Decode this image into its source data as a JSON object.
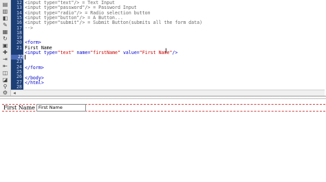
{
  "toolbar": {
    "icons": [
      "file-icon",
      "page-icon",
      "code-icon",
      "wrench-icon",
      "bookmark-icon",
      "refresh-icon",
      "nav-icon",
      "format-icon",
      "indent-icon",
      "outdent-icon",
      "comment-icon",
      "uncomment-icon",
      "search-icon",
      "snippet-icon"
    ]
  },
  "gutter": {
    "lines": [
      "12",
      "13",
      "14",
      "15",
      "16",
      "17",
      "18",
      "19",
      "20",
      "21",
      "22",
      "23",
      "24",
      "25",
      "26",
      "27",
      "28"
    ],
    "active_line": "22"
  },
  "code": {
    "l12": "<input type=\"text\"/> = Text Input",
    "l13": "<input type=\"password\"/> = Password Input",
    "l14": "<input type=\"radio\"/> = Radio selection button",
    "l15": "<input type=\"button\"/> = A Button...",
    "l16": "<input type=\"submit\"/> = Submit Button(submits all the form data)",
    "l17": "-->",
    "l19_tag": "<form>",
    "l20_text": "First Name",
    "l21_open": "<input ",
    "l21_a1": "type=",
    "l21_v1": "\"text\"",
    "l21_a2": " name=",
    "l21_v2": "\"firstName\"",
    "l21_a3": " value=",
    "l21_v3": "\"First Name\"",
    "l21_close": "/>",
    "l24_tag": "</form>",
    "l26_tag": "</body>",
    "l27_tag": "</html>"
  },
  "design": {
    "label": "First Name",
    "input_value": "First Name"
  }
}
